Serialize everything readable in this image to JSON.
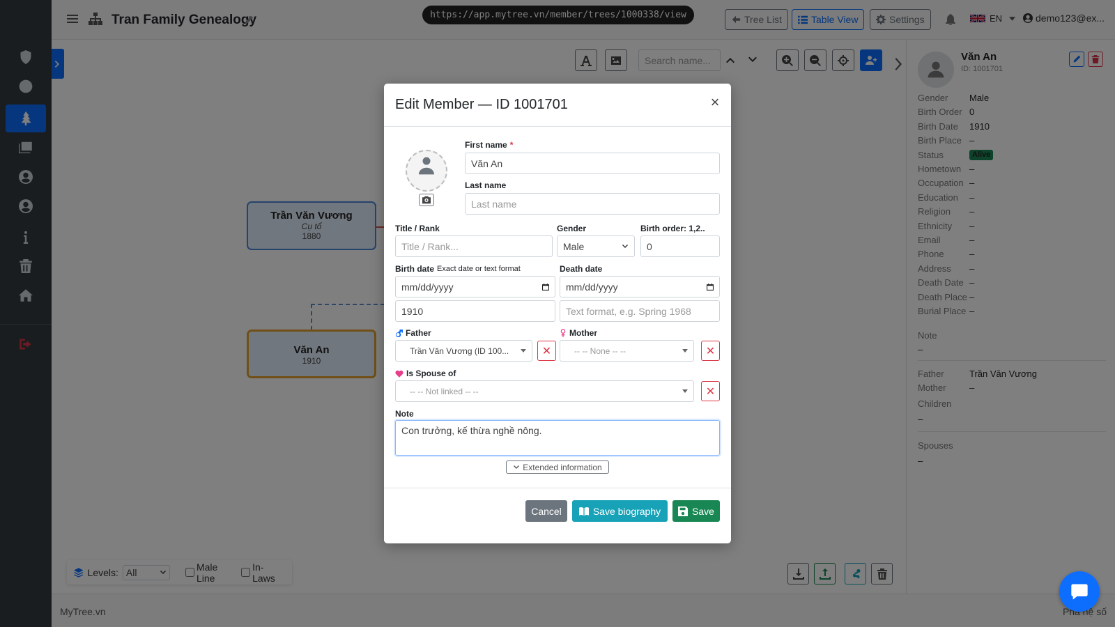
{
  "topbar": {
    "title": "Tran Family Genealogy",
    "url": "https://app.mytree.vn/member/trees/1000338/view",
    "tree_list": "Tree List",
    "table_view": "Table View",
    "settings": "Settings",
    "lang": "EN",
    "user": "demo123@ex..."
  },
  "canvas": {
    "search_placeholder": "Search name...",
    "nodes": [
      {
        "name": "Trần Văn Vương",
        "title": "Cụ tổ",
        "year": "1880"
      },
      {
        "name": "Văn An",
        "year": "1910"
      }
    ],
    "levels_label": "Levels:",
    "levels_value": "All",
    "male_line": "Male Line",
    "in_laws": "In-Laws"
  },
  "footer": {
    "brand": "MyTree.vn",
    "right": "Phả hệ số"
  },
  "right_panel": {
    "name": "Văn An",
    "id": "ID: 1001701",
    "rows": [
      {
        "k": "Gender",
        "v": "Male"
      },
      {
        "k": "Birth Order",
        "v": "0"
      },
      {
        "k": "Birth Date",
        "v": "1910"
      },
      {
        "k": "Birth Place",
        "v": "–"
      },
      {
        "k": "Status",
        "v": "Alive"
      },
      {
        "k": "Hometown",
        "v": "–"
      },
      {
        "k": "Occupation",
        "v": "–"
      },
      {
        "k": "Education",
        "v": "–"
      },
      {
        "k": "Religion",
        "v": "–"
      },
      {
        "k": "Ethnicity",
        "v": "–"
      },
      {
        "k": "Email",
        "v": "–"
      },
      {
        "k": "Phone",
        "v": "–"
      },
      {
        "k": "Address",
        "v": "–"
      },
      {
        "k": "Death Date",
        "v": "–"
      },
      {
        "k": "Death Place",
        "v": "–"
      },
      {
        "k": "Burial Place",
        "v": "–"
      }
    ],
    "note_label": "Note",
    "note_value": "–",
    "father_label": "Father",
    "father_value": "Trần Văn Vương",
    "mother_label": "Mother",
    "mother_value": "–",
    "children_label": "Children",
    "children_value": "–",
    "spouses_label": "Spouses",
    "spouses_value": "–"
  },
  "modal": {
    "title": "Edit Member — ID 1001701",
    "close": "×",
    "first_name_label": "First name",
    "first_name_required": "*",
    "first_name_value": "Văn An",
    "last_name_label": "Last name",
    "last_name_placeholder": "Last name",
    "title_label": "Title / Rank",
    "title_placeholder": "Title / Rank...",
    "gender_label": "Gender",
    "gender_value": "Male",
    "birth_order_label": "Birth order: 1,2..",
    "birth_order_value": "0",
    "birth_date_label": "Birth date",
    "birth_date_hint": "Exact date or text format",
    "birth_date_placeholder": "mm/dd/yyyy",
    "birth_text_value": "1910",
    "death_date_label": "Death date",
    "death_date_placeholder": "mm/dd/yyyy",
    "death_text_placeholder": "Text format, e.g. Spring 1968",
    "father_label": "Father",
    "father_value": "Trần Văn Vương (ID 100...",
    "mother_label": "Mother",
    "mother_value": "-- -- None -- --",
    "spouse_label": "Is Spouse of",
    "spouse_value": "-- -- Not linked -- --",
    "note_label": "Note",
    "note_value": "Con trưởng, kế thừa nghề nông.",
    "extended_label": "Extended information",
    "cancel": "Cancel",
    "save_bio": "Save biography",
    "save": "Save"
  },
  "colors": {
    "primary": "#0d6efd",
    "success": "#198754",
    "info": "#17a2b8",
    "danger": "#dc3545",
    "sidebar": "#343a40"
  }
}
